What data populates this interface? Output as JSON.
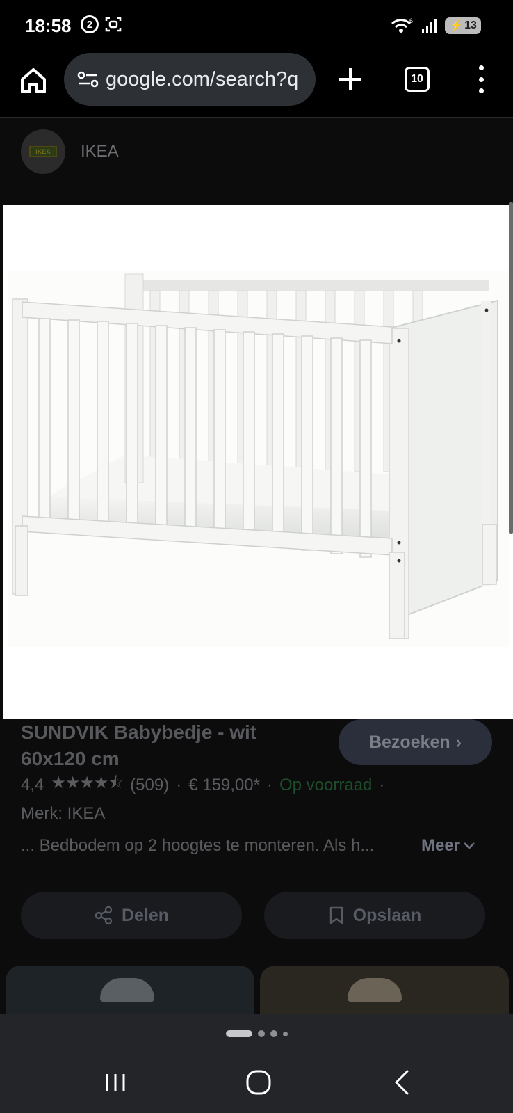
{
  "status_bar": {
    "time": "18:58",
    "notification_badge": "2",
    "battery_level": "13",
    "icons": [
      "whatsapp-notification-icon",
      "screenshot-icon",
      "wifi-icon",
      "signal-icon",
      "battery-charging-icon"
    ]
  },
  "browser": {
    "url": "google.com/search?q",
    "tab_count": "10",
    "icons": [
      "home-icon",
      "site-settings-icon",
      "plus-icon",
      "overflow-menu-icon"
    ]
  },
  "result": {
    "source_name": "IKEA",
    "source_logo_text": "IKEA",
    "title": "SUNDVIK Babybedje - wit 60x120 cm",
    "visit_label": "Bezoeken",
    "rating_value": "4,4",
    "rating_stars": 4.4,
    "review_count": "(509)",
    "separator": "·",
    "price": "€ 159,00*",
    "availability": "Op voorraad",
    "brand": "Merk: IKEA",
    "description": "... Bedbodem op 2 hoogtes te monteren. Als h...",
    "more_label": "Meer",
    "share_label": "Delen",
    "save_label": "Opslaan"
  },
  "carousel": {
    "page_count": 4,
    "active_page": 1
  },
  "colors": {
    "accent_green": "#1d4d2a",
    "omnibox_bg": "#2d3035",
    "visit_button_bg": "#2b2f3b"
  }
}
